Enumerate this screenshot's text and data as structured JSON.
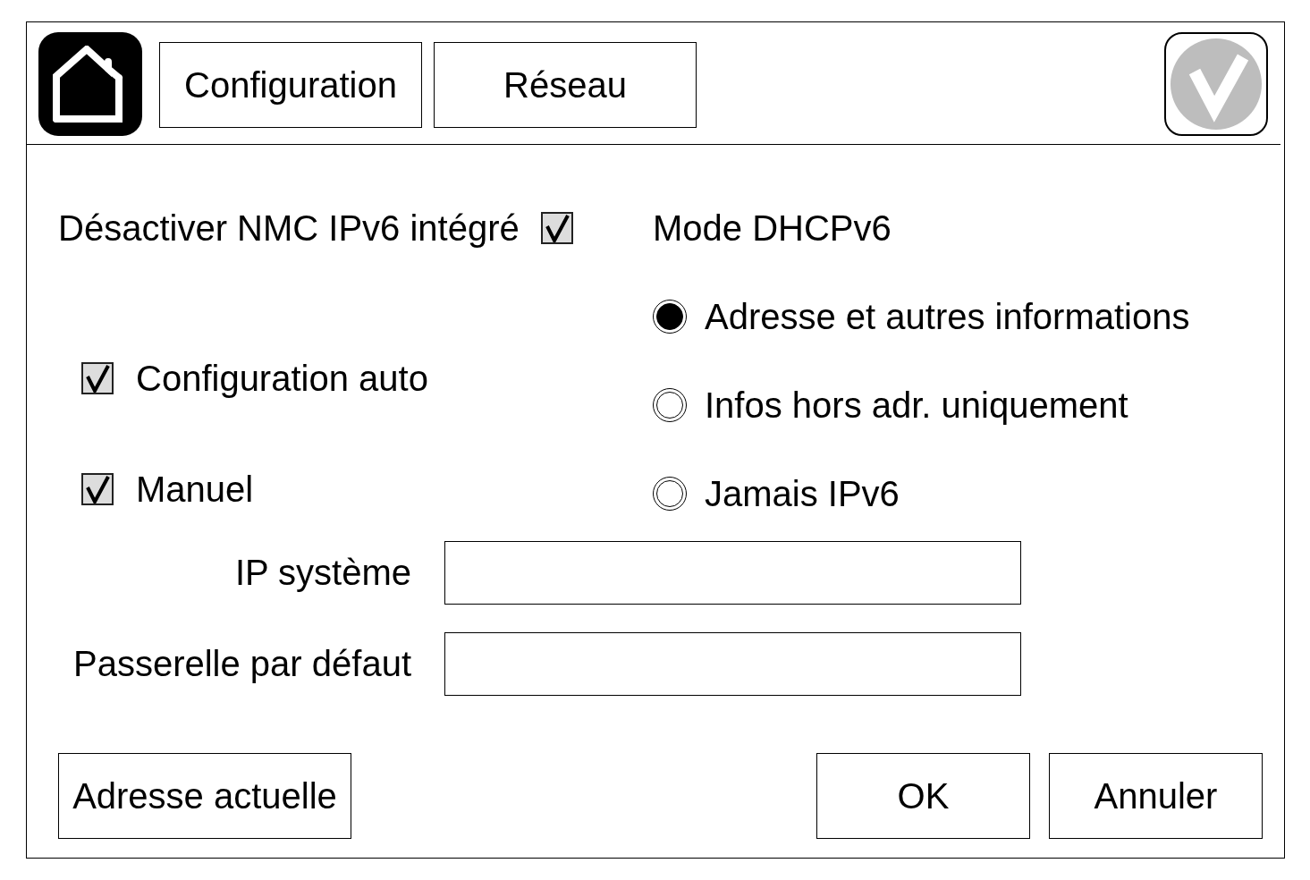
{
  "nav_buttons": [
    "Configuration",
    "Réseau"
  ],
  "disable_ipv6": {
    "label": "Désactiver NMC IPv6 intégré",
    "checked": true
  },
  "modes": [
    {
      "label": "Configuration auto",
      "checked": true
    },
    {
      "label": "Manuel",
      "checked": true
    }
  ],
  "dhcpv6": {
    "title": "Mode DHCPv6",
    "options": [
      {
        "label": "Adresse et autres informations",
        "selected": true
      },
      {
        "label": "Infos hors adr. uniquement",
        "selected": false
      },
      {
        "label": "Jamais IPv6",
        "selected": false
      }
    ]
  },
  "fields": [
    {
      "label": "IP système"
    },
    {
      "label": "Passerelle par défaut"
    }
  ],
  "left_button": "Adresse actuelle",
  "buttons": [
    "OK",
    "Annuler"
  ]
}
